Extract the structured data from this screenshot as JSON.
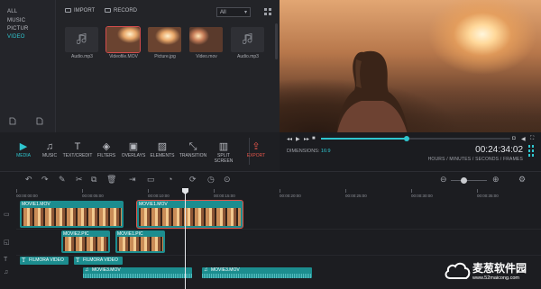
{
  "sidebar": {
    "items": [
      {
        "label": "ALL"
      },
      {
        "label": "MUSIC"
      },
      {
        "label": "PICTUR"
      },
      {
        "label": "VIDEO"
      }
    ]
  },
  "media": {
    "import_label": "IMPORT",
    "record_label": "RECORD",
    "filter_value": "All",
    "files": [
      {
        "label": "Audio.mp3",
        "kind": "audio"
      },
      {
        "label": "Videofile.MOV",
        "kind": "video"
      },
      {
        "label": "Picture.jpg",
        "kind": "picture"
      },
      {
        "label": "Video.mov",
        "kind": "video"
      },
      {
        "label": "Audio.mp3",
        "kind": "audio"
      }
    ]
  },
  "toolbar": {
    "tools": [
      {
        "label": "MEDIA",
        "icon": "play-icon"
      },
      {
        "label": "MUSIC",
        "icon": "music-icon"
      },
      {
        "label": "TEXT/CREDIT",
        "icon": "text-icon"
      },
      {
        "label": "FILTERS",
        "icon": "filters-icon"
      },
      {
        "label": "OVERLAYS",
        "icon": "overlays-icon"
      },
      {
        "label": "ELEMENTS",
        "icon": "image-icon"
      },
      {
        "label": "TRANSITION",
        "icon": "transition-icon"
      },
      {
        "label": "SPLIT SCREEN",
        "icon": "split-icon"
      },
      {
        "label": "EXPORT",
        "icon": "export-icon"
      }
    ]
  },
  "player": {
    "dimensions_label": "DIMENSIONS:",
    "dimensions_value": "16:9",
    "timecode": "00:24:34:02",
    "time_units": "HOURS / MINUTES / SECONDS / FRAMES",
    "progress": 0.45
  },
  "timeline": {
    "ruler": [
      "00:00:00:00",
      "00:00:05:00",
      "00:00:10:00",
      "00:00:15:00",
      "00:00:20:00",
      "00:00:25:00",
      "00:00:30:00",
      "00:00:35:00",
      "00:00:40:00"
    ],
    "clips": {
      "video1": "MOVIE1.MOV",
      "video2": "MOVIE1.MOV",
      "pic1": "MOVIE2.PIC",
      "pic2": "MOVIE1.PIC",
      "title1": "FILMORA VIDEO",
      "title2": "FILMORA VIDEO",
      "audio1": "MOVIE3.MOV",
      "audio2": "MOVIE3.MOV"
    }
  },
  "watermark": {
    "name": "麦葱软件园",
    "url": "www.52maicong.com"
  },
  "colors": {
    "accent": "#2fc6cf",
    "clip": "#1c8d8f",
    "export": "#e5564b",
    "selection": "#e0534a"
  }
}
